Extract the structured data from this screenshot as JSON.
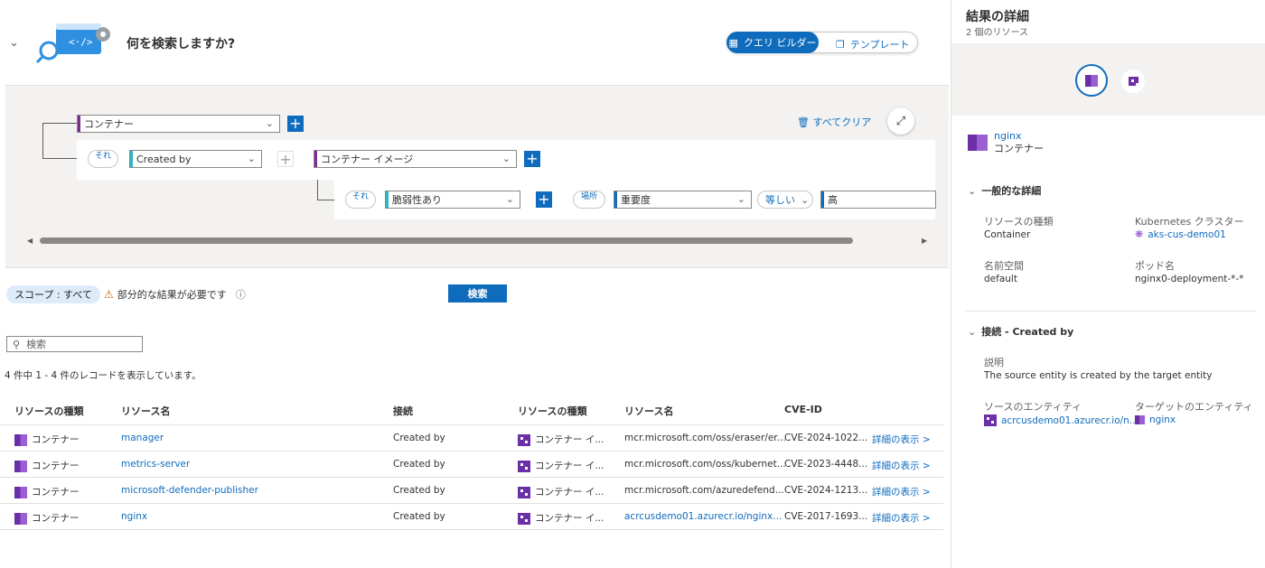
{
  "header": {
    "title": "何を検索しますか?",
    "toggle": {
      "query_builder": "クエリ ビルダー",
      "template": "テンプレート"
    }
  },
  "builder": {
    "root_select": "コンテナー",
    "clear_all": "すべてクリア",
    "row1": {
      "pill": "それ",
      "relation": "Created by",
      "target": "コンテナー イメージ"
    },
    "row2": {
      "pill": "それ",
      "condition": "脆弱性あり",
      "where_pill": "場所",
      "field": "重要度",
      "operator": "等しい",
      "value": "高"
    }
  },
  "toolbar": {
    "scope_label": "スコープ : すべて",
    "warning": "部分的な結果が必要です",
    "search_button": "検索"
  },
  "search": {
    "placeholder": "検索"
  },
  "records_summary": "4 件中 1 - 4 件のレコードを表示しています。",
  "table": {
    "headers": [
      "リソースの種類",
      "リソース名",
      "接続",
      "リソースの種類",
      "リソース名",
      "CVE-ID"
    ],
    "rows": [
      {
        "type": "コンテナー",
        "name": "manager",
        "connection": "Created by",
        "type2": "コンテナー イ...",
        "name2": "mcr.microsoft.com/oss/eraser/er...",
        "cve": "CVE-2024-1022...",
        "details": "詳細の表示 >"
      },
      {
        "type": "コンテナー",
        "name": "metrics-server",
        "connection": "Created by",
        "type2": "コンテナー イ...",
        "name2": "mcr.microsoft.com/oss/kubernet...",
        "cve": "CVE-2023-4448...",
        "details": "詳細の表示 >"
      },
      {
        "type": "コンテナー",
        "name": "microsoft-defender-publisher",
        "connection": "Created by",
        "type2": "コンテナー イ...",
        "name2": "mcr.microsoft.com/azuredefend...",
        "cve": "CVE-2024-1213...",
        "details": "詳細の表示 >"
      },
      {
        "type": "コンテナー",
        "name": "nginx",
        "connection": "Created by",
        "type2": "コンテナー イ...",
        "name2": "acrcusdemo01.azurecr.io/nginx...",
        "cve": "CVE-2017-1693...",
        "details": "詳細の表示 >"
      }
    ]
  },
  "details_panel": {
    "title": "結果の詳細",
    "subtitle": "2 個のリソース",
    "entity": {
      "name": "nginx",
      "type": "コンテナー"
    },
    "general": {
      "heading": "一般的な詳細",
      "resource_type_label": "リソースの種類",
      "resource_type_value": "Container",
      "cluster_label": "Kubernetes クラスター",
      "cluster_value": "aks-cus-demo01",
      "namespace_label": "名前空間",
      "namespace_value": "default",
      "pod_label": "ポッド名",
      "pod_value": "nginx0-deployment-*-*"
    },
    "connection": {
      "heading": "接続 - Created by",
      "desc_label": "説明",
      "desc_value": "The source entity is created by the target entity",
      "source_label": "ソースのエンティティ",
      "source_value": "acrcusdemo01.azurecr.io/n...",
      "target_label": "ターゲットのエンティティ",
      "target_value": "nginx"
    }
  },
  "colors": {
    "accent": "#0f6cbd",
    "purple": "#6b2fa8",
    "teal": "#2bb5c5"
  }
}
